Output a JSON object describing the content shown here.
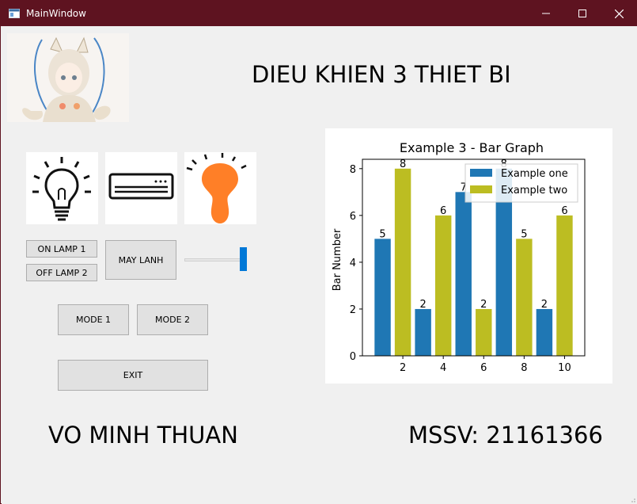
{
  "window": {
    "title": "MainWindow"
  },
  "header": {
    "title": "DIEU KHIEN 3 THIET BI"
  },
  "icons": [
    "lightbulb-outline-icon",
    "air-conditioner-icon",
    "lightbulb-on-icon"
  ],
  "controls": {
    "on_lamp": "ON LAMP 1",
    "off_lamp": "OFF LAMP 2",
    "may_lanh": "MAY LANH",
    "mode1": "MODE 1",
    "mode2": "MODE 2",
    "exit": "EXIT",
    "slider_level": 1.0
  },
  "footer": {
    "name": "VO MINH THUAN",
    "mssv": "MSSV: 21161366"
  },
  "colors": {
    "titlebar": "#5e1320",
    "series1": "#1f77b4",
    "series2": "#bcbd22",
    "bulb": "#ff7f27",
    "accent": "#0078d7"
  },
  "chart_data": {
    "type": "bar",
    "title": "Example 3 - Bar Graph",
    "xlabel": "",
    "ylabel": "Bar Number",
    "xlim": [
      0,
      11
    ],
    "ylim": [
      0,
      8.4
    ],
    "xticks": [
      2,
      4,
      6,
      8,
      10
    ],
    "yticks": [
      0,
      2,
      4,
      6,
      8
    ],
    "legend_position": "top-right",
    "series": [
      {
        "name": "Example one",
        "color": "#1f77b4",
        "x": [
          1,
          3,
          5,
          7,
          9
        ],
        "values": [
          5,
          2,
          7,
          8,
          2
        ]
      },
      {
        "name": "Example two",
        "color": "#bcbd22",
        "x": [
          2,
          4,
          6,
          8,
          10
        ],
        "values": [
          8,
          6,
          2,
          5,
          6
        ]
      }
    ]
  }
}
